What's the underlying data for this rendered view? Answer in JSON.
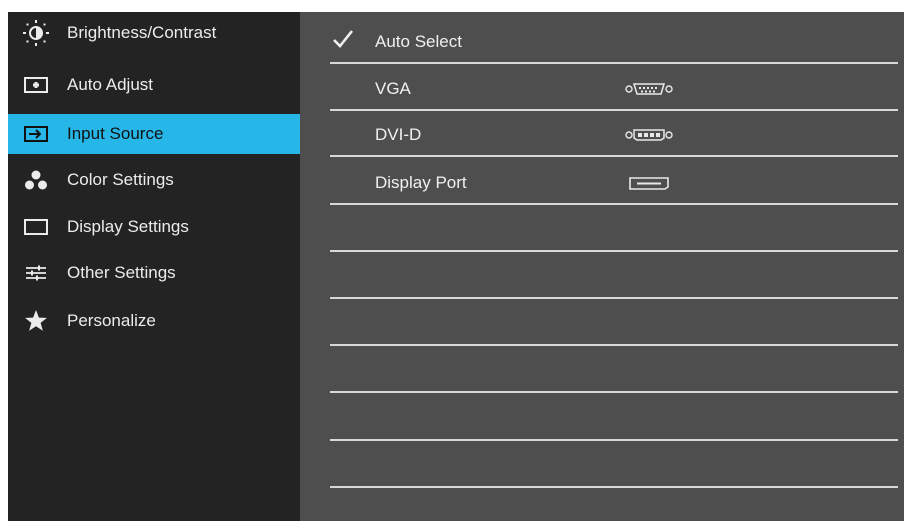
{
  "menu": {
    "items": [
      {
        "label": "Brightness/Contrast",
        "icon": "sun-icon"
      },
      {
        "label": "Auto Adjust",
        "icon": "auto-adjust-icon"
      },
      {
        "label": "Input Source",
        "icon": "input-source-icon",
        "selected": true
      },
      {
        "label": "Color Settings",
        "icon": "color-dots-icon"
      },
      {
        "label": "Display Settings",
        "icon": "display-rectangle-icon"
      },
      {
        "label": "Other Settings",
        "icon": "sliders-icon"
      },
      {
        "label": "Personalize",
        "icon": "star-icon"
      }
    ]
  },
  "input_source": {
    "options": [
      {
        "label": "Auto Select",
        "checked": true
      },
      {
        "label": "VGA",
        "icon": "vga-port-icon"
      },
      {
        "label": "DVI-D",
        "icon": "dvi-port-icon"
      },
      {
        "label": "Display Port",
        "icon": "displayport-icon"
      }
    ]
  },
  "colors": {
    "accent": "#27b6e8",
    "sidebar_bg": "#232323",
    "panel_bg": "#4e4e4e",
    "divider": "#d8d8d8"
  }
}
